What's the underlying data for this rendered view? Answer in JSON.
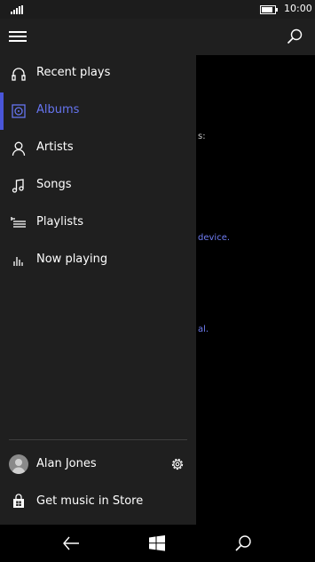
{
  "status_bar": {
    "time": "10:00",
    "battery_level": 0.85
  },
  "drawer": {
    "items": [
      {
        "label": "Recent plays",
        "icon": "headphones-icon",
        "selected": false
      },
      {
        "label": "Albums",
        "icon": "album-icon",
        "selected": true
      },
      {
        "label": "Artists",
        "icon": "person-icon",
        "selected": false
      },
      {
        "label": "Songs",
        "icon": "music-note-icon",
        "selected": false
      },
      {
        "label": "Playlists",
        "icon": "playlist-icon",
        "selected": false
      },
      {
        "label": "Now playing",
        "icon": "equalizer-icon",
        "selected": false
      }
    ],
    "user": {
      "name": "Alan Jones",
      "icon": "settings-gear-icon"
    },
    "store": {
      "label": "Get music in Store",
      "icon": "store-bag-icon"
    }
  },
  "background_content": {
    "fragment_1": "s:",
    "fragment_2": "device.",
    "fragment_3": "al."
  },
  "colors": {
    "accent": "#4a56d9",
    "link": "#6f7cf2",
    "drawer_bg": "#1f1f1f"
  }
}
